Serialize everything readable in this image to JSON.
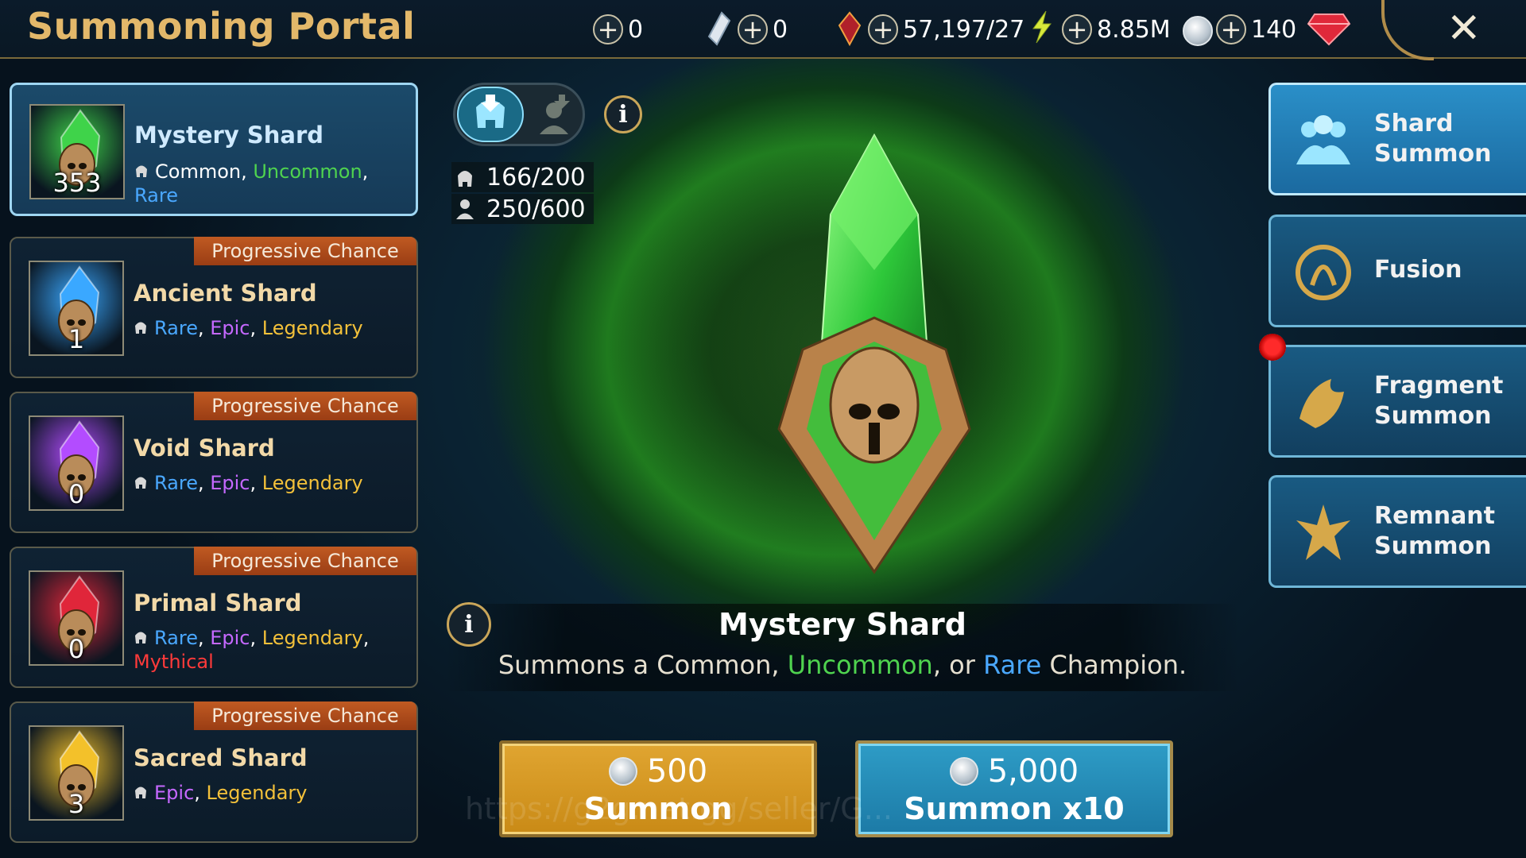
{
  "header": {
    "title": "Summoning Portal",
    "resources": [
      {
        "icon": "plus-icon",
        "value": "0",
        "resource_icon": "crystal-shard-icon"
      },
      {
        "icon": "plus-icon",
        "value": "0",
        "resource_icon": "red-gem-icon"
      },
      {
        "icon": "plus-icon",
        "value": "57,197/27",
        "resource_icon": "energy-bolt-icon"
      },
      {
        "icon": "plus-icon",
        "value": "8.85M",
        "resource_icon": "silver-coin-icon"
      },
      {
        "icon": "plus-icon",
        "value": "140",
        "resource_icon": "ruby-gem-icon"
      }
    ],
    "close_icon": "close-icon"
  },
  "shards": [
    {
      "name": "Mystery Shard",
      "count": "353",
      "active": true,
      "progressive": false,
      "rarities": [
        {
          "label": "Common",
          "class": "common"
        },
        {
          "label": "Uncommon",
          "class": "uncommon"
        },
        {
          "label": "Rare",
          "class": "rare"
        }
      ],
      "color": "#3fd34a"
    },
    {
      "name": "Ancient Shard",
      "count": "1",
      "active": false,
      "progressive": true,
      "rarities": [
        {
          "label": "Rare",
          "class": "rare"
        },
        {
          "label": "Epic",
          "class": "epic"
        },
        {
          "label": "Legendary",
          "class": "legendary"
        }
      ],
      "color": "#3aa8ff"
    },
    {
      "name": "Void Shard",
      "count": "0",
      "active": false,
      "progressive": true,
      "rarities": [
        {
          "label": "Rare",
          "class": "rare"
        },
        {
          "label": "Epic",
          "class": "epic"
        },
        {
          "label": "Legendary",
          "class": "legendary"
        }
      ],
      "color": "#b34cff"
    },
    {
      "name": "Primal Shard",
      "count": "0",
      "active": false,
      "progressive": true,
      "rarities": [
        {
          "label": "Rare",
          "class": "rare"
        },
        {
          "label": "Epic",
          "class": "epic"
        },
        {
          "label": "Legendary",
          "class": "legendary"
        },
        {
          "label": "Mythical",
          "class": "mythical"
        }
      ],
      "color": "#e0263a"
    },
    {
      "name": "Sacred Shard",
      "count": "3",
      "active": false,
      "progressive": true,
      "rarities": [
        {
          "label": "Epic",
          "class": "epic"
        },
        {
          "label": "Legendary",
          "class": "legendary"
        }
      ],
      "color": "#f3c12a"
    }
  ],
  "progressive_label": "Progressive Chance",
  "counters": [
    {
      "icon": "champion-helm-icon",
      "value": "166/200"
    },
    {
      "icon": "person-icon",
      "value": "250/600"
    }
  ],
  "description": {
    "title": "Mystery Shard",
    "prefix": "Summons a Common, ",
    "uncommon": "Uncommon",
    "middle": ", or ",
    "rare": "Rare",
    "suffix": " Champion."
  },
  "buttons": {
    "single_cost": "500",
    "single_label": "Summon",
    "multi_cost": "5,000",
    "multi_label": "Summon x10"
  },
  "side_menu": [
    {
      "label_1": "Shard",
      "label_2": "Summon",
      "icon": "shard-summon-icon",
      "active": true
    },
    {
      "label_1": "Fusion",
      "label_2": "",
      "icon": "fusion-icon",
      "active": false
    },
    {
      "label_1": "Fragment",
      "label_2": "Summon",
      "icon": "fragment-summon-icon",
      "active": false
    },
    {
      "label_1": "Remnant",
      "label_2": "Summon",
      "icon": "remnant-summon-icon",
      "active": false
    }
  ],
  "watermark": "https://g2g.net.gg/seller/G..."
}
